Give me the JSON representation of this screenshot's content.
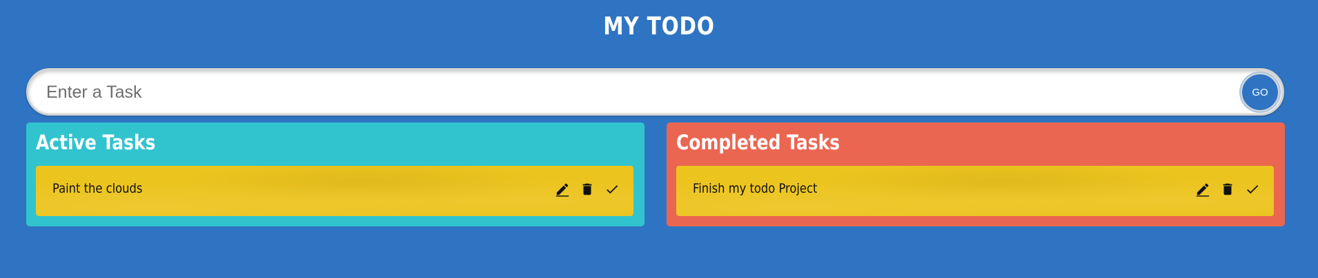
{
  "app": {
    "title": "MY TODO"
  },
  "search": {
    "placeholder": "Enter a Task",
    "value": "",
    "go_label": "GO"
  },
  "active_panel": {
    "title": "Active Tasks",
    "tasks": [
      {
        "text": "Paint the clouds"
      }
    ]
  },
  "completed_panel": {
    "title": "Completed Tasks",
    "tasks": [
      {
        "text": "Finish my todo Project"
      }
    ]
  },
  "task_actions": {
    "icons": [
      "edit-icon",
      "delete-icon",
      "check-icon"
    ]
  },
  "colors": {
    "background": "#2f74c2",
    "active_panel": "#31c3ce",
    "completed_panel": "#eb6651",
    "task_card": "#ecc41e",
    "go_button": "#2f74c2"
  }
}
